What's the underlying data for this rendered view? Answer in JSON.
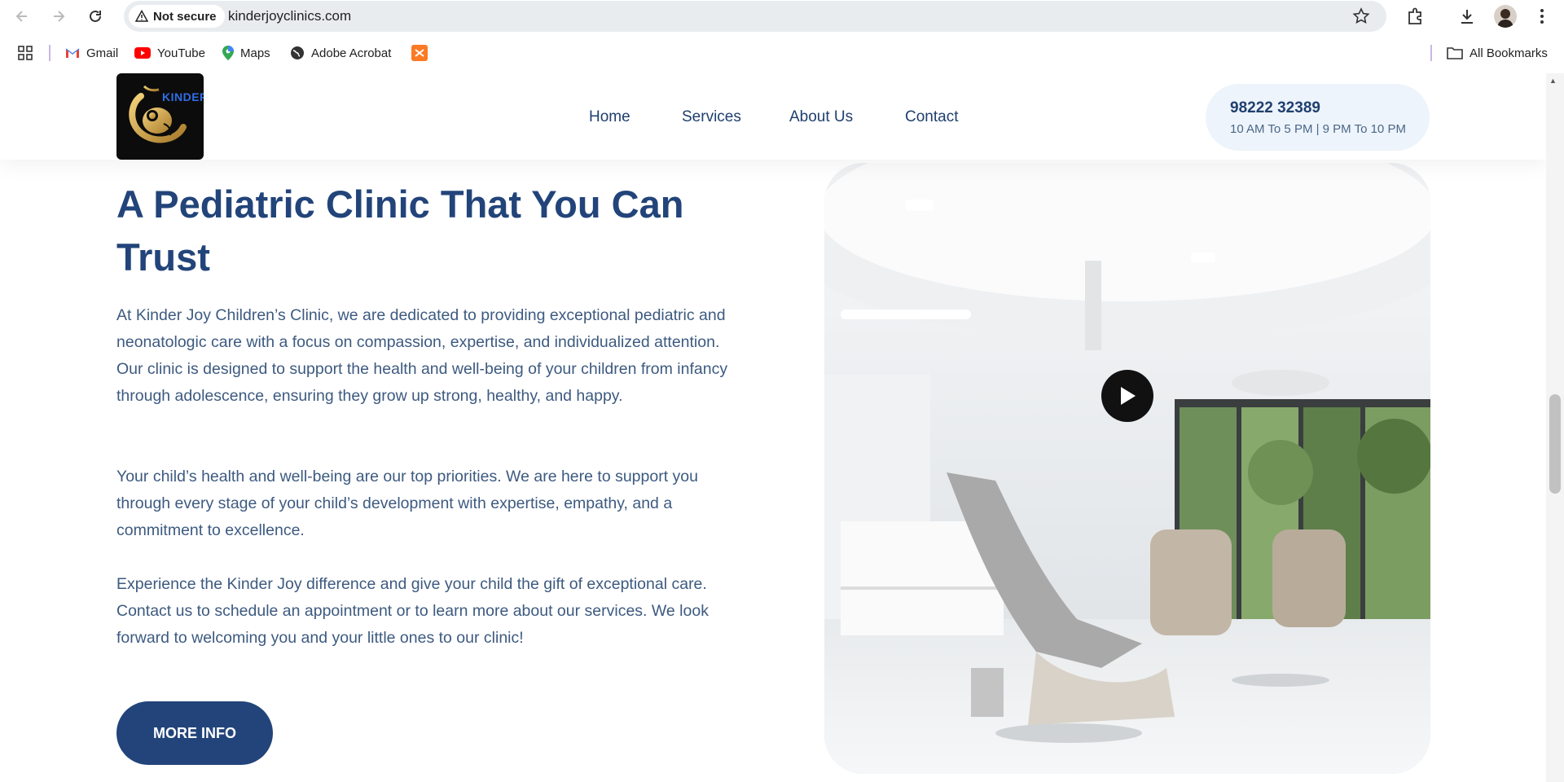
{
  "browser": {
    "security_label": "Not secure",
    "url": "kinderjoyclinics.com"
  },
  "bookmarks": [
    {
      "label": "Gmail"
    },
    {
      "label": "YouTube"
    },
    {
      "label": "Maps"
    },
    {
      "label": "Adobe Acrobat"
    }
  ],
  "all_bookmarks_label": "All Bookmarks",
  "site": {
    "logo_text": "KINDER",
    "nav": [
      "Home",
      "Services",
      "About Us",
      "Contact"
    ],
    "phone": "98222 32389",
    "hours": "10 AM To 5 PM | 9 PM To 10 PM"
  },
  "main": {
    "heading_line1": "A Pediatric Clinic That You Can",
    "heading_line2": "Trust",
    "paragraph1": "At Kinder Joy Children’s Clinic, we are dedicated to providing exceptional pediatric and neonatologic care with a focus on compassion, expertise, and individualized attention. Our clinic is designed to support the health and well-being of your children from infancy through adolescence, ensuring they grow up strong, healthy, and happy.",
    "paragraph2": "Your child’s health and well-being are our top priorities. We are here to support you through every stage of your child’s development with expertise, empathy, and a commitment to excellence.",
    "paragraph3": "Experience the Kinder Joy difference and give your child the gift of exceptional care. Contact us to schedule an appointment or to learn more about our services. We look forward to welcoming you and your little ones to our clinic!",
    "button_label": "MORE INFO"
  },
  "colors": {
    "brand_navy": "#22447a",
    "body_text": "#3d5a80",
    "pill_bg": "#eef4fb"
  }
}
